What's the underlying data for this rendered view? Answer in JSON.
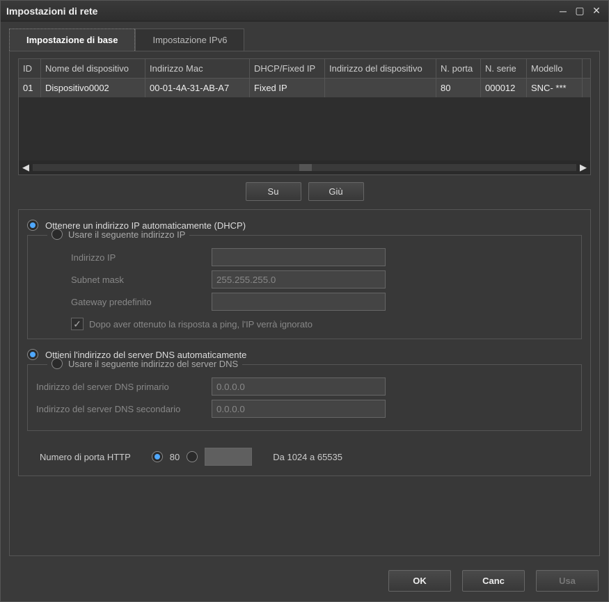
{
  "window": {
    "title": "Impostazioni di rete"
  },
  "tabs": [
    {
      "label": "Impostazione di base",
      "active": true
    },
    {
      "label": "Impostazione IPv6",
      "active": false
    }
  ],
  "table": {
    "headers": [
      "ID",
      "Nome del dispositivo",
      "Indirizzo Mac",
      "DHCP/Fixed IP",
      "Indirizzo del dispositivo",
      "N. porta",
      "N. serie",
      "Modello"
    ],
    "rows": [
      {
        "id": "01",
        "name": "Dispositivo0002",
        "mac": "00-01-4A-31-AB-A7",
        "dhcp": "Fixed IP",
        "ipaddr": "",
        "port": "80",
        "serial": "000012",
        "model": "SNC- ***"
      }
    ]
  },
  "buttons": {
    "up": "Su",
    "down": "Giù",
    "ok": "OK",
    "cancel": "Canc",
    "use": "Usa"
  },
  "ip": {
    "dhcp_label": "Ottenere un indirizzo IP automaticamente (DHCP)",
    "static_label": "Usare il seguente indirizzo IP",
    "fields": {
      "ip_label": "Indirizzo IP",
      "ip_value": "",
      "mask_label": "Subnet mask",
      "mask_value": "255.255.255.0",
      "gw_label": "Gateway predefinito",
      "gw_value": ""
    },
    "ping_label": "Dopo aver ottenuto la risposta a ping, l'IP verrà ignorato"
  },
  "dns": {
    "auto_label": "Ottieni l'indirizzo del server DNS automaticamente",
    "static_label": "Usare il seguente indirizzo del server DNS",
    "primary_label": "Indirizzo del server DNS primario",
    "primary_value": "0.0.0.0",
    "secondary_label": "Indirizzo del server DNS secondario",
    "secondary_value": "0.0.0.0"
  },
  "http": {
    "label": "Numero di porta HTTP",
    "opt80": "80",
    "custom_value": "",
    "range_label": "Da 1024 a 65535"
  }
}
